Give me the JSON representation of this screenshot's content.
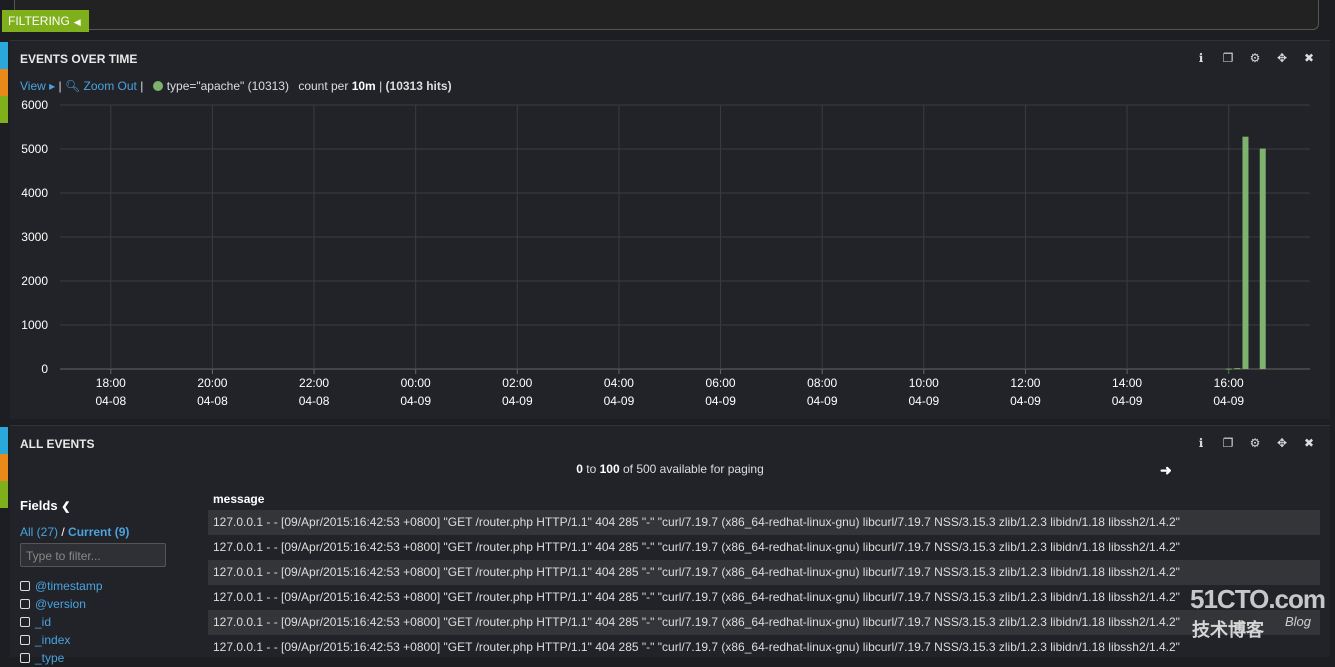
{
  "filter_tab": {
    "label": "FILTERING"
  },
  "chart_panel": {
    "title": "EVENTS OVER TIME",
    "view_label": "View",
    "zoom_label": "Zoom Out",
    "query_label": "type=\"apache\" (10313)",
    "count_prefix": "count per",
    "interval": "10m",
    "hits_label": "(10313 hits)",
    "series_color": "#7eb26d"
  },
  "chart_data": {
    "type": "bar",
    "yticks": [
      "0",
      "1000",
      "2000",
      "3000",
      "4000",
      "5000",
      "6000"
    ],
    "ylim": [
      0,
      6000
    ],
    "xticks": [
      {
        "time": "18:00",
        "date": "04-08"
      },
      {
        "time": "20:00",
        "date": "04-08"
      },
      {
        "time": "22:00",
        "date": "04-08"
      },
      {
        "time": "00:00",
        "date": "04-09"
      },
      {
        "time": "02:00",
        "date": "04-09"
      },
      {
        "time": "04:00",
        "date": "04-09"
      },
      {
        "time": "06:00",
        "date": "04-09"
      },
      {
        "time": "08:00",
        "date": "04-09"
      },
      {
        "time": "10:00",
        "date": "04-09"
      },
      {
        "time": "12:00",
        "date": "04-09"
      },
      {
        "time": "14:00",
        "date": "04-09"
      },
      {
        "time": "16:00",
        "date": "04-09"
      }
    ],
    "x_start_hour": 17.0,
    "x_end_hour": 41.6,
    "series": [
      {
        "values": [
          {
            "x": 40.0,
            "y": 10
          },
          {
            "x": 40.17,
            "y": 20
          },
          {
            "x": 40.33,
            "y": 5280
          },
          {
            "x": 40.67,
            "y": 5010
          }
        ]
      }
    ]
  },
  "events_panel": {
    "title": "ALL EVENTS",
    "paging_from": "0",
    "paging_to": "to",
    "paging_count": "100",
    "paging_rest": "of 500 available for paging",
    "fields_title": "Fields",
    "all_label": "All (27)",
    "sep": "/",
    "current_label": "Current (9)",
    "filter_placeholder": "Type to filter...",
    "field_items": [
      "@timestamp",
      "@version",
      "_id",
      "_index",
      "_type"
    ],
    "column_header": "message",
    "rows": [
      "127.0.0.1 - - [09/Apr/2015:16:42:53 +0800] \"GET /router.php HTTP/1.1\" 404 285 \"-\" \"curl/7.19.7 (x86_64-redhat-linux-gnu) libcurl/7.19.7 NSS/3.15.3 zlib/1.2.3 libidn/1.18 libssh2/1.4.2\"",
      "127.0.0.1 - - [09/Apr/2015:16:42:53 +0800] \"GET /router.php HTTP/1.1\" 404 285 \"-\" \"curl/7.19.7 (x86_64-redhat-linux-gnu) libcurl/7.19.7 NSS/3.15.3 zlib/1.2.3 libidn/1.18 libssh2/1.4.2\"",
      "127.0.0.1 - - [09/Apr/2015:16:42:53 +0800] \"GET /router.php HTTP/1.1\" 404 285 \"-\" \"curl/7.19.7 (x86_64-redhat-linux-gnu) libcurl/7.19.7 NSS/3.15.3 zlib/1.2.3 libidn/1.18 libssh2/1.4.2\"",
      "127.0.0.1 - - [09/Apr/2015:16:42:53 +0800] \"GET /router.php HTTP/1.1\" 404 285 \"-\" \"curl/7.19.7 (x86_64-redhat-linux-gnu) libcurl/7.19.7 NSS/3.15.3 zlib/1.2.3 libidn/1.18 libssh2/1.4.2\"",
      "127.0.0.1 - - [09/Apr/2015:16:42:53 +0800] \"GET /router.php HTTP/1.1\" 404 285 \"-\" \"curl/7.19.7 (x86_64-redhat-linux-gnu) libcurl/7.19.7 NSS/3.15.3 zlib/1.2.3 libidn/1.18 libssh2/1.4.2\"",
      "127.0.0.1 - - [09/Apr/2015:16:42:53 +0800] \"GET /router.php HTTP/1.1\" 404 285 \"-\" \"curl/7.19.7 (x86_64-redhat-linux-gnu) libcurl/7.19.7 NSS/3.15.3 zlib/1.2.3 libidn/1.18 libssh2/1.4.2\""
    ]
  },
  "watermark": {
    "text": "51CTO.com",
    "sub": "技术博客",
    "blog": "Blog"
  }
}
